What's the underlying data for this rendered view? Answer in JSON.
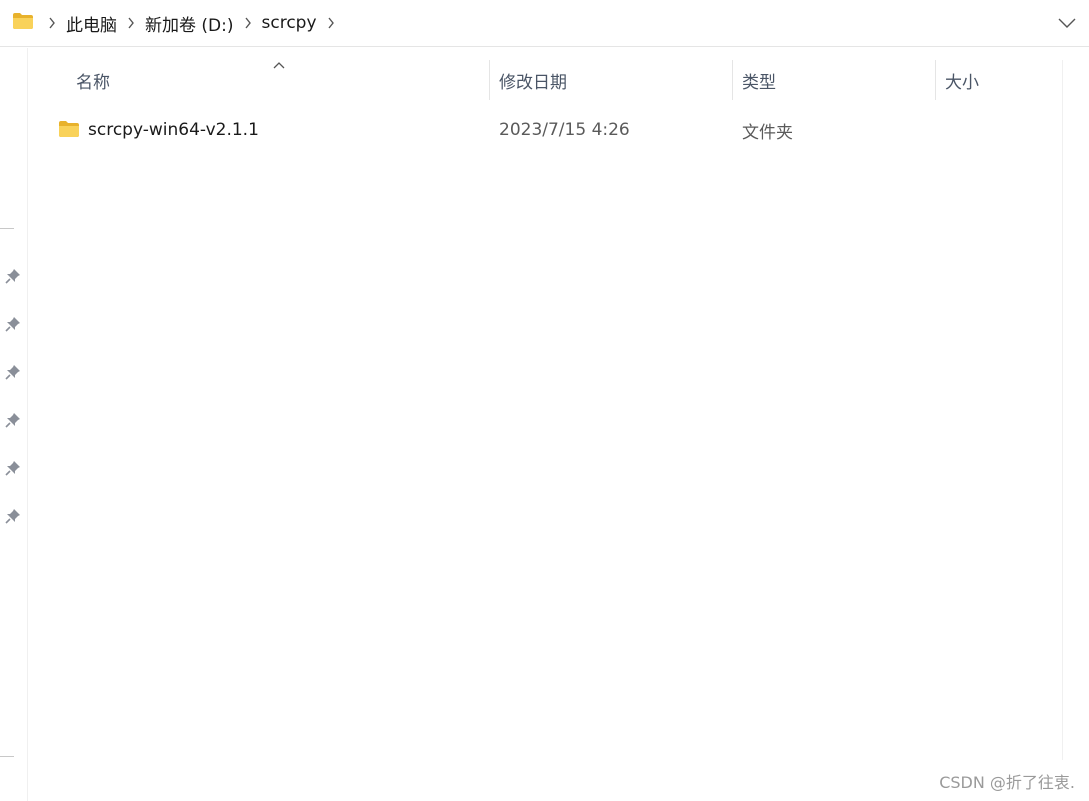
{
  "address_bar": {
    "breadcrumbs": [
      "此电脑",
      "新加卷 (D:)",
      "scrcpy"
    ]
  },
  "columns": {
    "name": "名称",
    "date": "修改日期",
    "type": "类型",
    "size": "大小"
  },
  "files": [
    {
      "name": "scrcpy-win64-v2.1.1",
      "date": "2023/7/15 4:26",
      "type": "文件夹",
      "size": ""
    }
  ],
  "watermark": "CSDN @折了往衷.",
  "colors": {
    "folder_yellow": "#f4c53f",
    "header_text": "#4a5566",
    "pin_gray": "#8a8f99"
  },
  "icons": {
    "address_folder": "folder-icon",
    "breadcrumb_separator": "chevron-right-icon",
    "dropdown": "chevron-down-icon",
    "sort": "sort-caret-icon",
    "quick_access": "pin-icon"
  }
}
